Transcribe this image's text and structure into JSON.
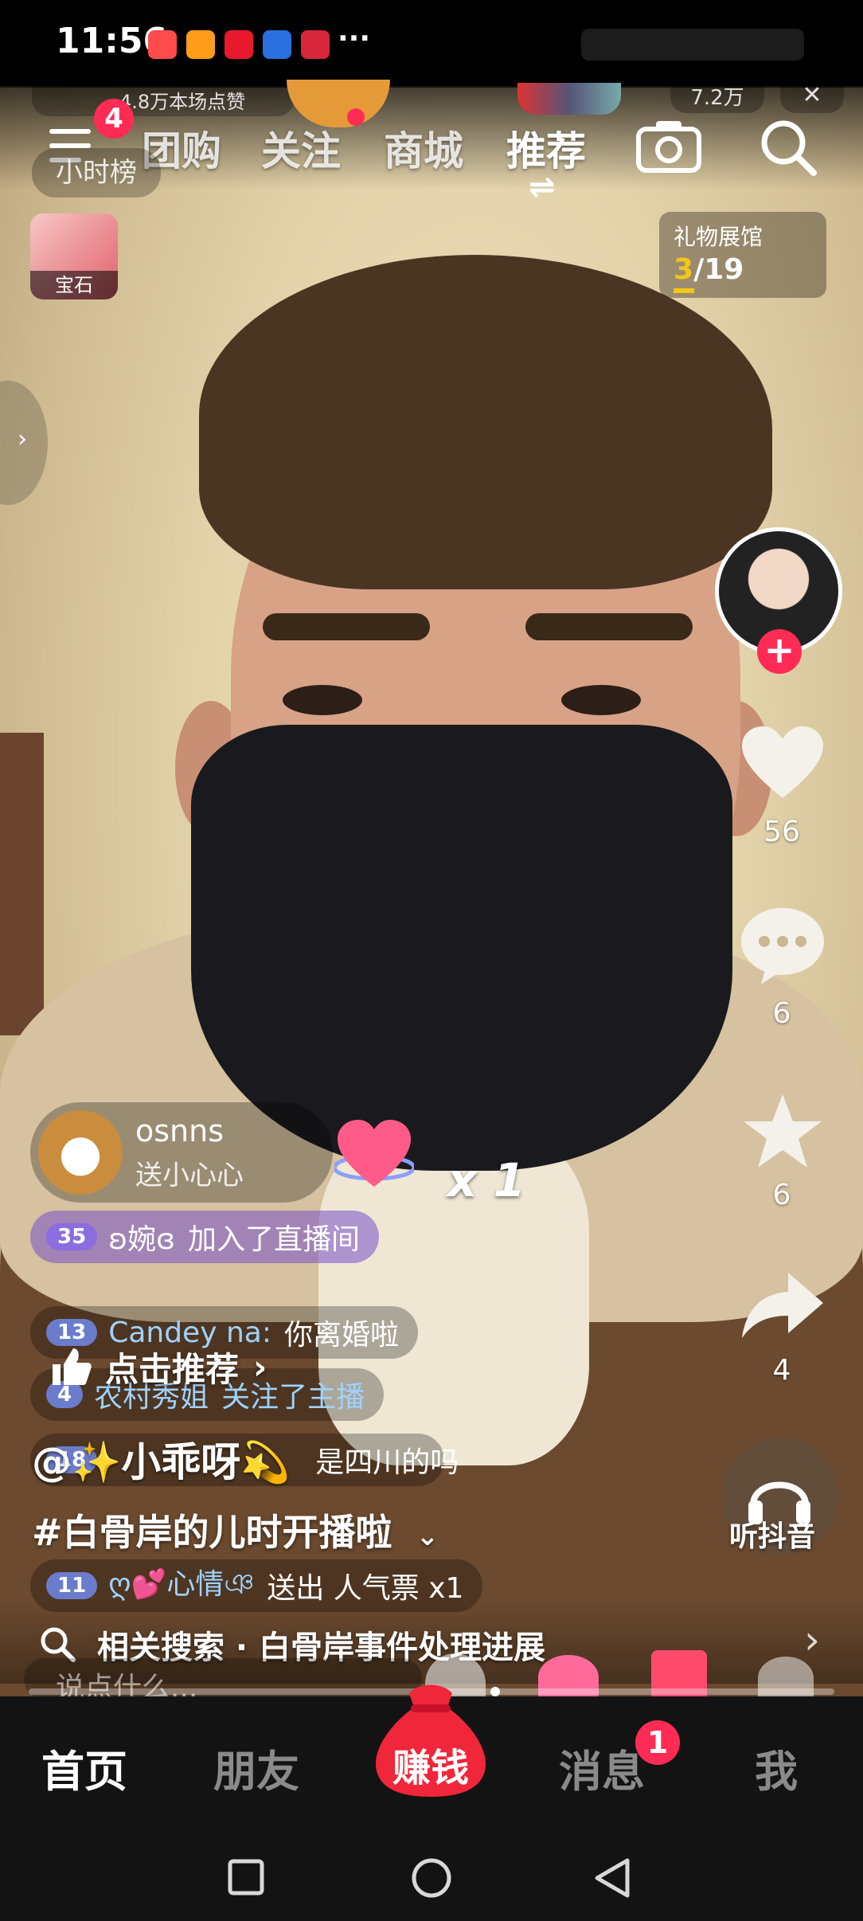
{
  "status_bar": {
    "time": "11:56",
    "more": "···"
  },
  "top_info": {
    "likes_text": "4.8万本场点赞",
    "viewer_count": "7.2万"
  },
  "nav": {
    "menu_badge": "4",
    "tabs": [
      "团购",
      "关注",
      "商城",
      "推荐"
    ],
    "active_tab": "推荐",
    "switch_glyph": "⇌"
  },
  "hourly_rank": "小时榜",
  "gem_label": "宝石",
  "gift_hall": {
    "title": "礼物展馆",
    "current": "3",
    "total": "/19"
  },
  "right_rail": {
    "likes": "56",
    "comments": "6",
    "favorites": "6",
    "shares": "4",
    "listen_label": "听抖音"
  },
  "gift_pop": {
    "user": "osnns",
    "action": "送小心心",
    "multiplier": "x 1"
  },
  "chat": [
    {
      "level": "35",
      "name": "ʚ婉ɞ",
      "text": "加入了直播间"
    },
    {
      "level": "13",
      "name": "Candey na:",
      "text": "你离婚啦"
    },
    {
      "level": "4",
      "name": "农村秀姐",
      "text": "关注了主播"
    },
    {
      "level": "18",
      "name": "",
      "text": "是四川的吗"
    },
    {
      "level": "11",
      "name": "ღ💕心情ঞ",
      "text": "送出 人气票 x1"
    }
  ],
  "recommend_btn": "点击推荐",
  "streamer_name": "@✨小乖呀💫",
  "hashtag": "#白骨岸的儿时开播啦",
  "related_search": {
    "prefix": "相关搜索",
    "dot": " · ",
    "query": "白骨岸事件处理进展"
  },
  "comment_placeholder": "说点什么...",
  "bottom_nav": {
    "home": "首页",
    "friends": "朋友",
    "earn": "赚钱",
    "messages": "消息",
    "messages_badge": "1",
    "me": "我"
  },
  "colors": {
    "accent": "#fe2c55",
    "gold": "#f5c518"
  }
}
